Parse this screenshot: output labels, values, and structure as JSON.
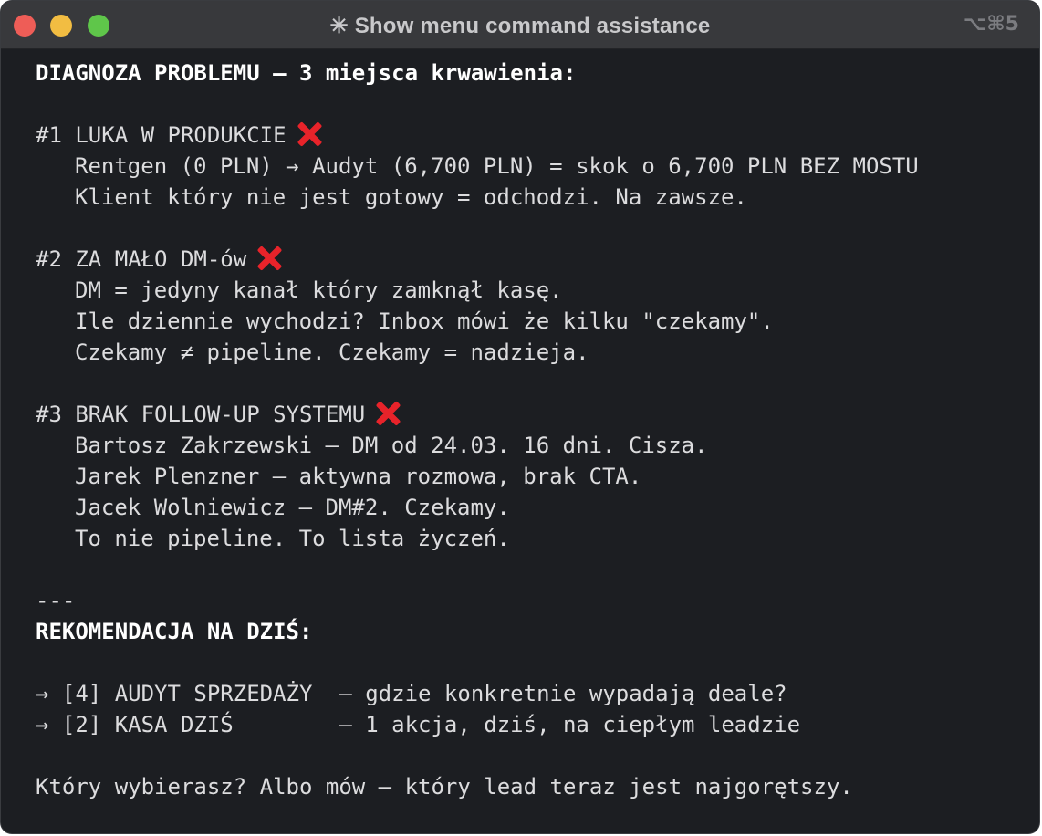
{
  "window": {
    "title": "✳ Show menu command assistance",
    "shortcut": "⌥⌘5"
  },
  "terminal": {
    "heading": "DIAGNOZA PROBLEMU — 3 miejsca krwawienia:",
    "problems": [
      {
        "title": "#1 LUKA W PRODUKCIE",
        "lines": [
          "Rentgen (0 PLN) → Audyt (6,700 PLN) = skok o 6,700 PLN BEZ MOSTU",
          "Klient który nie jest gotowy = odchodzi. Na zawsze."
        ]
      },
      {
        "title": "#2 ZA MAŁO DM-ów",
        "lines": [
          "DM = jedyny kanał który zamknął kasę.",
          "Ile dziennie wychodzi? Inbox mówi że kilku \"czekamy\".",
          "Czekamy ≠ pipeline. Czekamy = nadzieja."
        ]
      },
      {
        "title": "#3 BRAK FOLLOW-UP SYSTEMU",
        "lines": [
          "Bartosz Zakrzewski — DM od 24.03. 16 dni. Cisza.",
          "Jarek Plenzner — aktywna rozmowa, brak CTA.",
          "Jacek Wolniewicz — DM#2. Czekamy.",
          "To nie pipeline. To lista życzeń."
        ]
      }
    ],
    "separator": "---",
    "recommendation_heading": "REKOMENDACJA NA DZIŚ:",
    "options": [
      "→ [4] AUDYT SPRZEDAŻY  — gdzie konkretnie wypadają deale?",
      "→ [2] KASA DZIŚ        — 1 akcja, dziś, na ciepłym leadzie"
    ],
    "question": "Który wybierasz? Albo mów — który lead teraz jest najgorętszy."
  },
  "icons": {
    "problem_marker": "cross-mark-icon",
    "cross_color": "#e8232a"
  }
}
